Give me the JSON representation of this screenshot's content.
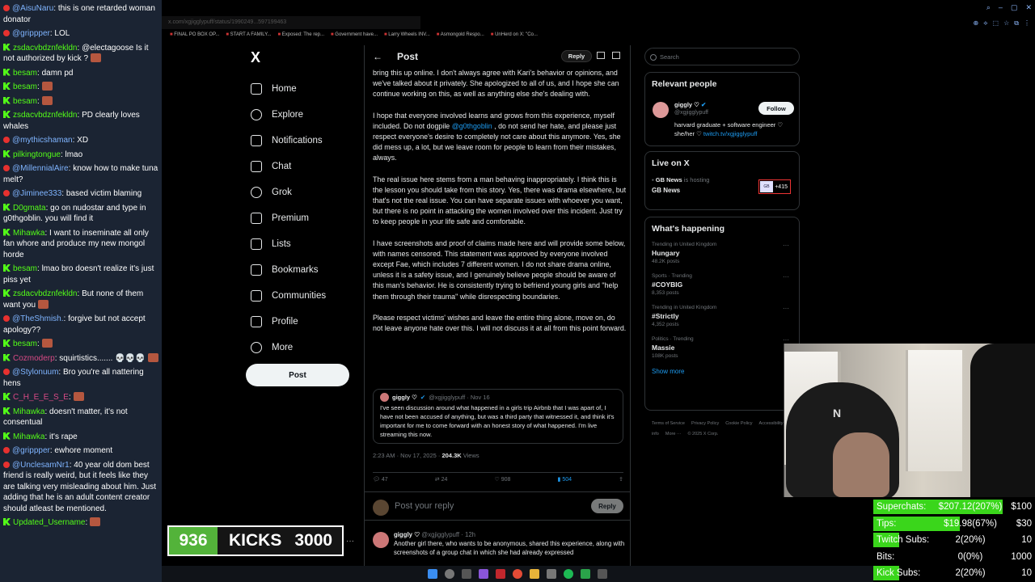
{
  "browser": {
    "url": "x.com/xgjigglypuff/status/1990249...597199463",
    "bookmarks": [
      "FINAL PO BOX OP...",
      "START A FAMILY...",
      "Exposed: The rep...",
      "Government have...",
      "Larry Wheels INV...",
      "Asmongold Respo...",
      "UnHerd on X: \"Co..."
    ]
  },
  "chat": {
    "messages": [
      {
        "platform": "yt",
        "user": "@AisuNaru",
        "text": "this is one retarded woman donator",
        "emote": false
      },
      {
        "platform": "yt",
        "user": "@grippper",
        "text": "LOL",
        "emote": false
      },
      {
        "platform": "kick",
        "user": "zsdacvbdznfekldn",
        "text": "@electagoose Is it not authorized by kick ?",
        "emote": true
      },
      {
        "platform": "kick",
        "user": "besam",
        "text": "damn pd",
        "emote": false
      },
      {
        "platform": "kick",
        "user": "besam",
        "text": "",
        "emote": true
      },
      {
        "platform": "kick",
        "user": "besam",
        "text": "",
        "emote": true
      },
      {
        "platform": "kick",
        "user": "zsdacvbdznfekldn",
        "text": "PD clearly loves whales",
        "emote": false
      },
      {
        "platform": "yt",
        "user": "@mythicshaman",
        "text": "XD",
        "emote": false
      },
      {
        "platform": "kick",
        "user": "pilkingtongue",
        "text": "lmao",
        "emote": false
      },
      {
        "platform": "yt",
        "user": "@MillennialAire",
        "text": "know how to make tuna melt?",
        "emote": false
      },
      {
        "platform": "yt",
        "user": "@Jiminee333",
        "text": "based victim blaming",
        "emote": false
      },
      {
        "platform": "kick",
        "user": "D0gmata",
        "text": "go on nudostar and type in g0thgoblin. you will find it",
        "emote": false
      },
      {
        "platform": "kick",
        "user": "Mihawka",
        "text": "I want to inseminate all only fan whore and produce my new mongol horde",
        "emote": false
      },
      {
        "platform": "kick",
        "user": "besam",
        "text": "lmao bro doesn't realize it's just piss yet",
        "emote": false
      },
      {
        "platform": "kick",
        "user": "zsdacvbdznfekldn",
        "text": "But none of them want you",
        "emote": true
      },
      {
        "platform": "yt",
        "user": "@TheShmish.",
        "text": "forgive but not accept apology??",
        "emote": false
      },
      {
        "platform": "kick",
        "user": "besam",
        "text": "",
        "emote": true
      },
      {
        "platform": "kick",
        "user": "Cozmoderp",
        "text": "squirtistics....... 💀💀💀",
        "emote": true
      },
      {
        "platform": "yt",
        "user": "@Stylonuum",
        "text": "Bro you're all nattering hens",
        "emote": false
      },
      {
        "platform": "kick",
        "user": "C_H_E_E_S_E",
        "text": "",
        "emote": true
      },
      {
        "platform": "kick",
        "user": "Mihawka",
        "text": "doesn't matter, it's not consentual",
        "emote": false
      },
      {
        "platform": "kick",
        "user": "Mihawka",
        "text": "it's rape",
        "emote": false
      },
      {
        "platform": "yt",
        "user": "@grippper",
        "text": "ewhore moment",
        "emote": false
      },
      {
        "platform": "yt",
        "user": "@UnclesamNr1",
        "text": "40 year old dom best friend is really weird, but it feels like they are talking very misleading about him. Just adding that he is an adult content creator should atleast be mentioned.",
        "emote": false
      },
      {
        "platform": "kick",
        "user": "Updated_Username",
        "text": "",
        "emote": true
      }
    ],
    "colors": {
      "yt_user": "#7fb4ff",
      "kick_user": "#53fc18",
      "kick_alt_user": "#d94a85"
    }
  },
  "nav": {
    "logo": "X",
    "items": [
      {
        "label": "Home",
        "icon": "home-icon"
      },
      {
        "label": "Explore",
        "icon": "search-icon"
      },
      {
        "label": "Notifications",
        "icon": "bell-icon"
      },
      {
        "label": "Chat",
        "icon": "mail-icon"
      },
      {
        "label": "Grok",
        "icon": "grok-icon"
      },
      {
        "label": "Premium",
        "icon": "x-logo-icon"
      },
      {
        "label": "Lists",
        "icon": "list-icon"
      },
      {
        "label": "Bookmarks",
        "icon": "bookmark-icon"
      },
      {
        "label": "Communities",
        "icon": "people-icon"
      },
      {
        "label": "Profile",
        "icon": "person-icon"
      },
      {
        "label": "More",
        "icon": "more-icon"
      }
    ],
    "post_button": "Post"
  },
  "post": {
    "header_title": "Post",
    "reply_button": "Reply",
    "paragraphs": [
      "bring this up online. I don't always agree with Kari's behavior or opinions, and we've talked about it privately. She apologized to all of us, and I hope she can continue working on this, as well as anything else she's dealing with.",
      "I hope that everyone involved learns and grows from this experience, myself included. Do not dogpile @g0thgoblin , do not send her hate, and please just respect everyone's desire to completely not care about this anymore. Yes, she did mess up, a lot, but we leave room for people to learn from their mistakes, always.",
      "The real issue here stems from a man behaving inappropriately. I think this is the lesson you should take from this story. Yes, there was drama elsewhere, but that's not the real issue. You can have separate issues with whoever you want, but there is no point in attacking the women involved over this incident. Just try to keep people in your life safe and comfortable.",
      "I have screenshots and proof of claims made here and will provide some below, with names censored. This statement was approved by everyone involved except Fae, which includes 7 different women. I do not share drama online, unless it is a safety issue, and I genuinely believe people should be aware of this man's behavior.  He is consistently trying to befriend young girls and \"help them through their trauma\" while disrespecting boundaries.",
      "Please respect victims' wishes and leave the entire thing alone, move on, do not leave anyone hate over this. I will not discuss it at all from this point forward."
    ],
    "mention": "@g0thgoblin",
    "quote": {
      "name": "giggly ♡",
      "handle": "@xgjigglypuff · Nov 16",
      "text": "I've seen discussion around what happened in a girls trip Airbnb that I was apart of, I have not been accused of anything, but was a third party that witnessed it, and think it's important for me to come forward with an honest story of what happened. I'm live streaming this now."
    },
    "time": "2:23 AM · Nov 17, 2025 · ",
    "views_count": "204.3K",
    "views_label": " Views",
    "actions": {
      "replies": "47",
      "reposts": "24",
      "likes": "908",
      "bookmarks": "504"
    },
    "reply_placeholder": "Post your reply",
    "reply_submit": "Reply",
    "reply2": {
      "name": "giggly ♡",
      "handle": "@xgjigglypuff · 12h",
      "text": "Another girl there, who wants to be anonymous, shared this experience, along with screenshots of a group chat in which she had already expressed"
    }
  },
  "sidebar": {
    "search_placeholder": "Search",
    "relevant": {
      "title": "Relevant people",
      "name": "giggly ♡",
      "handle": "@xgjigglypuff",
      "follow": "Follow",
      "bio": "harvard graduate + software engineer ♡ she/her ♡ ",
      "bio_link": "twitch.tv/xgjigglypuff"
    },
    "live": {
      "title": "Live on X",
      "host": "GB News",
      "hosting": " is hosting",
      "name": "GB News",
      "count": "+415"
    },
    "happening": {
      "title": "What's happening",
      "trends": [
        {
          "context": "Trending in United Kingdom",
          "name": "Hungary",
          "count": "48.2K posts"
        },
        {
          "context": "Sports · Trending",
          "name": "#COYBIG",
          "count": "8,353 posts"
        },
        {
          "context": "Trending in United Kingdom",
          "name": "#Strictly",
          "count": "4,352 posts"
        },
        {
          "context": "Politics · Trending",
          "name": "Massie",
          "count": "108K posts"
        }
      ],
      "show_more": "Show more"
    },
    "footer": [
      "Terms of Service",
      "Privacy Policy",
      "Cookie Policy",
      "Accessibility",
      "Ads info",
      "More ···",
      "© 2025 X Corp."
    ]
  },
  "stats": {
    "rows": [
      {
        "label": "Superchats:",
        "value": "$207.12(207%)",
        "goal": "$100",
        "fill_pct": 100
      },
      {
        "label": "Tips:",
        "value": "$19.98(67%)",
        "goal": "$30",
        "fill_pct": 67
      },
      {
        "label": "Twitch Subs:",
        "value": "2(20%)",
        "goal": "10",
        "fill_pct": 20
      },
      {
        "label": "Bits:",
        "value": "0(0%)",
        "goal": "1000",
        "fill_pct": 0
      },
      {
        "label": "Kick Subs:",
        "value": "2(20%)",
        "goal": "10",
        "fill_pct": 20
      }
    ]
  },
  "kicks": {
    "count": "936",
    "label": "KICKS",
    "goal": "3000"
  }
}
